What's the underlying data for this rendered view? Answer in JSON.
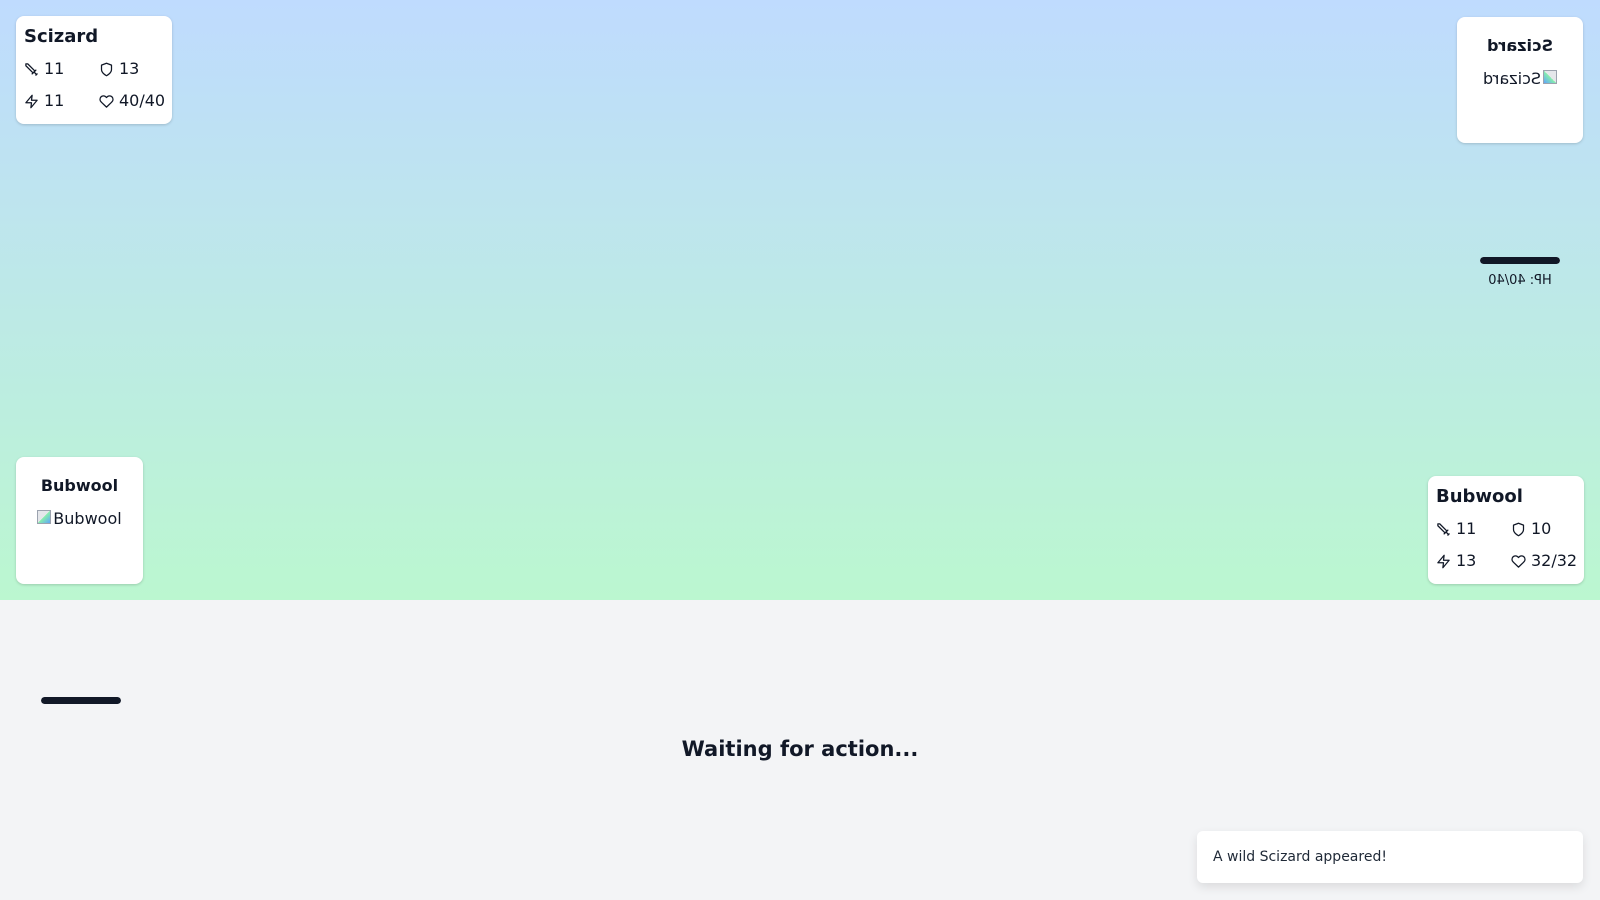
{
  "opponent": {
    "stats": {
      "name": "Scizard",
      "attack": "11",
      "defense": "13",
      "speed": "11",
      "hp": "40/40"
    },
    "sprite": {
      "name": "Scizard",
      "alt": "Scizard"
    },
    "hp_text": "HP: 40/40",
    "hp_fraction": 1.0
  },
  "player": {
    "stats": {
      "name": "Bubwool",
      "attack": "11",
      "defense": "10",
      "speed": "13",
      "hp": "32/32"
    },
    "sprite": {
      "name": "Bubwool",
      "alt": "Bubwool"
    },
    "hp_fraction": 1.0
  },
  "status_text": "Waiting for action...",
  "toast_message": "A wild Scizard appeared!",
  "icons": {
    "attack": "sword-icon",
    "defense": "shield-icon",
    "speed": "lightning-icon",
    "hp": "heart-icon"
  },
  "colors": {
    "sky_top": "#bfdbfe",
    "grass_bottom": "#bbf7d0",
    "hp_bar": "#111827"
  }
}
